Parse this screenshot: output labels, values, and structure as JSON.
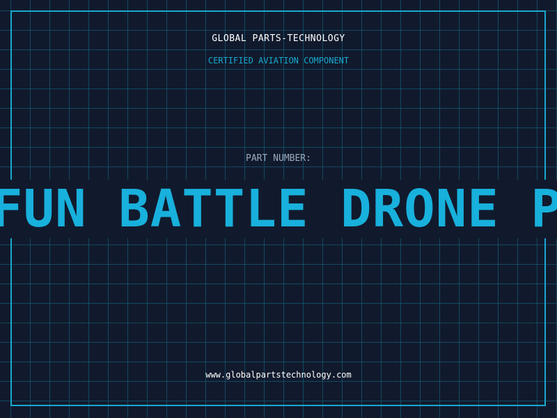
{
  "header": {
    "company": "GLOBAL PARTS-TECHNOLOGY",
    "tagline": "CERTIFIED AVIATION COMPONENT"
  },
  "part": {
    "label": "PART NUMBER:",
    "number": "FUN BATTLE DRONE PA"
  },
  "footer": {
    "url": "www.globalpartstechnology.com"
  },
  "colors": {
    "background": "#111a2d",
    "accent": "#18a9cf",
    "grid": "#146e8c",
    "text": "#ffffff",
    "muted": "#9aaabb"
  }
}
